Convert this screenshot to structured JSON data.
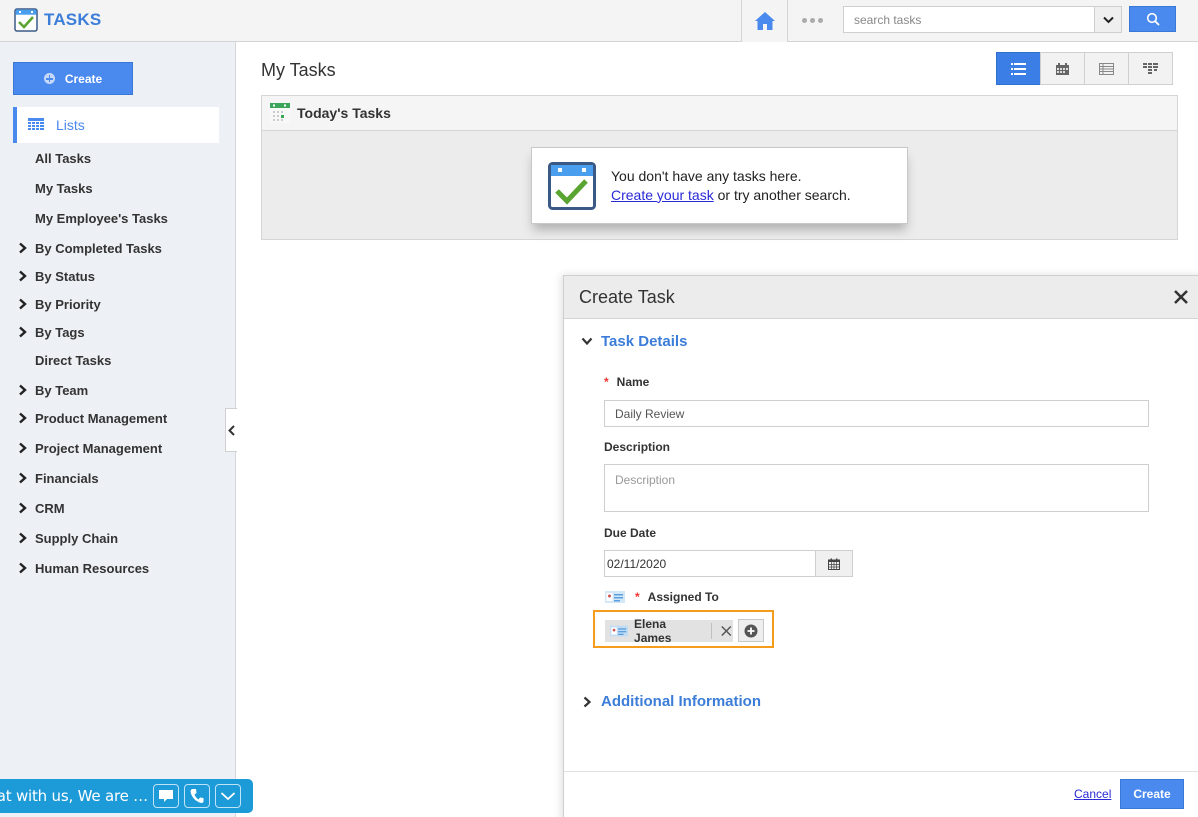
{
  "app": {
    "title": "TASKS",
    "accent_color": "#4a89ee"
  },
  "header": {
    "home_icon": "home-icon",
    "more_icon": "more-dots-icon",
    "search": {
      "placeholder": "search tasks",
      "value": ""
    },
    "search_button_icon": "search-icon"
  },
  "sidebar": {
    "create_label": "Create",
    "lists_label": "Lists",
    "items": [
      {
        "label": "All Tasks",
        "expandable": false
      },
      {
        "label": "My Tasks",
        "expandable": false
      },
      {
        "label": "My Employee's Tasks",
        "expandable": false
      },
      {
        "label": "By Completed Tasks",
        "expandable": true
      },
      {
        "label": "By Status",
        "expandable": true
      },
      {
        "label": "By Priority",
        "expandable": true
      },
      {
        "label": "By Tags",
        "expandable": true
      },
      {
        "label": "Direct Tasks",
        "expandable": false
      },
      {
        "label": "By Team",
        "expandable": true
      },
      {
        "label": "Product Management",
        "expandable": true
      },
      {
        "label": "Project Management",
        "expandable": true
      },
      {
        "label": "Financials",
        "expandable": true
      },
      {
        "label": "CRM",
        "expandable": true
      },
      {
        "label": "Supply Chain",
        "expandable": true
      },
      {
        "label": "Human Resources",
        "expandable": true
      }
    ]
  },
  "main": {
    "page_title": "My Tasks",
    "view_toggle": [
      {
        "name": "list-view",
        "active": true
      },
      {
        "name": "calendar-view",
        "active": false
      },
      {
        "name": "table-view",
        "active": false
      },
      {
        "name": "kanban-view",
        "active": false
      }
    ],
    "panel_title": "Today's Tasks",
    "empty_state": {
      "line1": "You don't have any tasks here.",
      "link": "Create your task",
      "line2_rest": " or try another search."
    }
  },
  "dialog": {
    "title": "Create Task",
    "section_task_details": "Task Details",
    "name_label": "Name",
    "name_value": "Daily Review",
    "description_label": "Description",
    "description_placeholder": "Description",
    "description_value": "",
    "due_date_label": "Due Date",
    "due_date_value": "02/11/2020",
    "assigned_label": "Assigned To",
    "assignee": "Elena James",
    "section_additional": "Additional Information",
    "cancel_label": "Cancel",
    "create_label": "Create"
  },
  "chat_widget": {
    "text": "Chat with us, We are …"
  }
}
